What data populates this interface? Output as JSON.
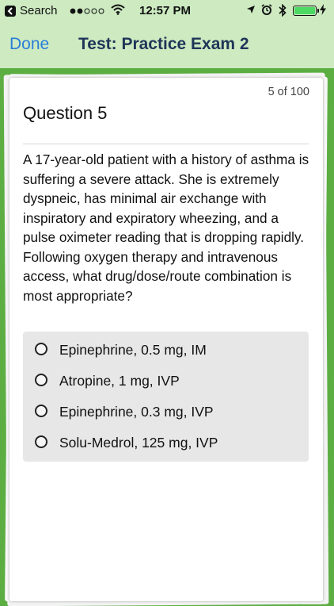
{
  "status_bar": {
    "back_app": "Search",
    "time": "12:57 PM"
  },
  "nav": {
    "done_label": "Done",
    "title": "Test: Practice Exam 2"
  },
  "question": {
    "counter": "5 of 100",
    "title": "Question 5",
    "text": "A 17-year-old patient with a history of asthma is suffering a severe attack. She is extremely dyspneic, has minimal air exchange with inspiratory and expiratory wheezing, and a pulse oximeter reading that is dropping rapidly. Following oxygen therapy and intravenous access, what drug/dose/route combination is most appropriate?",
    "options": [
      {
        "label": "Epinephrine, 0.5 mg, IM"
      },
      {
        "label": "Atropine, 1 mg, IVP"
      },
      {
        "label": "Epinephrine, 0.3 mg, IVP"
      },
      {
        "label": "Solu-Medrol, 125 mg, IVP"
      }
    ]
  },
  "colors": {
    "background_green": "#5cae43",
    "bar_green": "#cdeac1",
    "link_blue": "#2a7ed8",
    "title_navy": "#1f3558"
  }
}
